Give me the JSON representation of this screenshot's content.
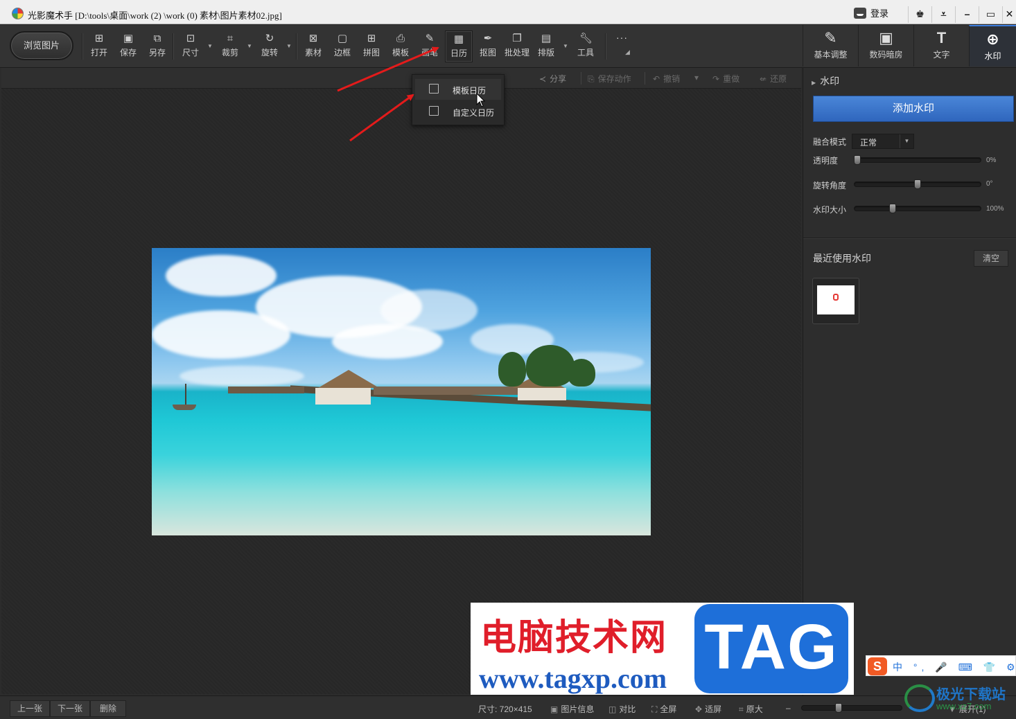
{
  "window": {
    "title": "光影魔术手 [D:\\tools\\桌面\\work (2) \\work (0) 素材\\图片素材02.jpg]",
    "login_label": "登录",
    "controls": [
      "shirt-icon",
      "menu-icon",
      "minimize-icon",
      "maximize-icon",
      "close-icon"
    ]
  },
  "toolbar": {
    "browse_label": "浏览图片",
    "tools": [
      {
        "id": "open",
        "label": "打开",
        "icon": "open-icon"
      },
      {
        "id": "save",
        "label": "保存",
        "icon": "save-icon"
      },
      {
        "id": "saveas",
        "label": "另存",
        "icon": "saveas-icon"
      },
      {
        "id": "size",
        "label": "尺寸",
        "icon": "size-icon"
      },
      {
        "id": "crop",
        "label": "裁剪",
        "icon": "crop-icon"
      },
      {
        "id": "rotate",
        "label": "旋转",
        "icon": "rotate-icon"
      },
      {
        "id": "material",
        "label": "素材",
        "icon": "material-icon"
      },
      {
        "id": "border",
        "label": "边框",
        "icon": "border-icon"
      },
      {
        "id": "collage",
        "label": "拼图",
        "icon": "collage-icon"
      },
      {
        "id": "template",
        "label": "模板",
        "icon": "template-icon"
      },
      {
        "id": "brush",
        "label": "画笔",
        "icon": "brush-icon"
      },
      {
        "id": "calendar",
        "label": "日历",
        "icon": "calendar-icon"
      },
      {
        "id": "cutout",
        "label": "抠图",
        "icon": "cutout-icon"
      },
      {
        "id": "batch",
        "label": "批处理",
        "icon": "batch-icon"
      },
      {
        "id": "layout",
        "label": "排版",
        "icon": "layout-icon"
      },
      {
        "id": "tools",
        "label": "工具",
        "icon": "wrench-icon"
      }
    ],
    "more_label": "···"
  },
  "right_tabs": [
    {
      "label": "基本调整",
      "icon": "adjust-icon"
    },
    {
      "label": "数码暗房",
      "icon": "darkroom-icon"
    },
    {
      "label": "文字",
      "icon": "text-icon"
    },
    {
      "label": "水印",
      "icon": "watermark-icon",
      "active": true
    }
  ],
  "subbar": {
    "share": "分享",
    "save_action": "保存动作",
    "undo": "撤销",
    "redo": "重做",
    "restore": "还原"
  },
  "calendar_menu": {
    "items": [
      {
        "label": "模板日历",
        "icon": "template-calendar-icon"
      },
      {
        "label": "自定义日历",
        "icon": "custom-calendar-icon"
      }
    ]
  },
  "watermark_panel": {
    "section_title": "水印",
    "add_button": "添加水印",
    "blend_label": "融合模式",
    "blend_value": "正常",
    "opacity_label": "透明度",
    "opacity_value": "0%",
    "opacity_level": 0,
    "rotation_label": "旋转角度",
    "rotation_value": "0°",
    "rotation_level": 0.5,
    "size_label": "水印大小",
    "size_value": "100%",
    "size_level": 0.3,
    "recent_title": "最近使用水印",
    "clear_button": "清空"
  },
  "bottombar": {
    "prev": "上一张",
    "next": "下一张",
    "delete": "删除",
    "size_label": "尺寸: ",
    "size_value": "720×415",
    "info": "图片信息",
    "compare": "对比",
    "fullscreen": "全屏",
    "fit": "适屏",
    "original": "原大",
    "expand": "展开(1)",
    "zoom_level": 0.33
  },
  "overlay_banner": {
    "cn_text": "电脑技术网",
    "url": "www.tagxp.com",
    "tag": "TAG"
  },
  "ime": {
    "logo": "S",
    "items": "中 °, 🎤 ⌨ 👕 ⚙"
  },
  "corner_logo": {
    "title": "极光下载站",
    "url": "www.xz7.com"
  },
  "colors": {
    "accent": "#3e7fe0",
    "arrow": "#e41b1b",
    "background": "#2c2c2c"
  }
}
